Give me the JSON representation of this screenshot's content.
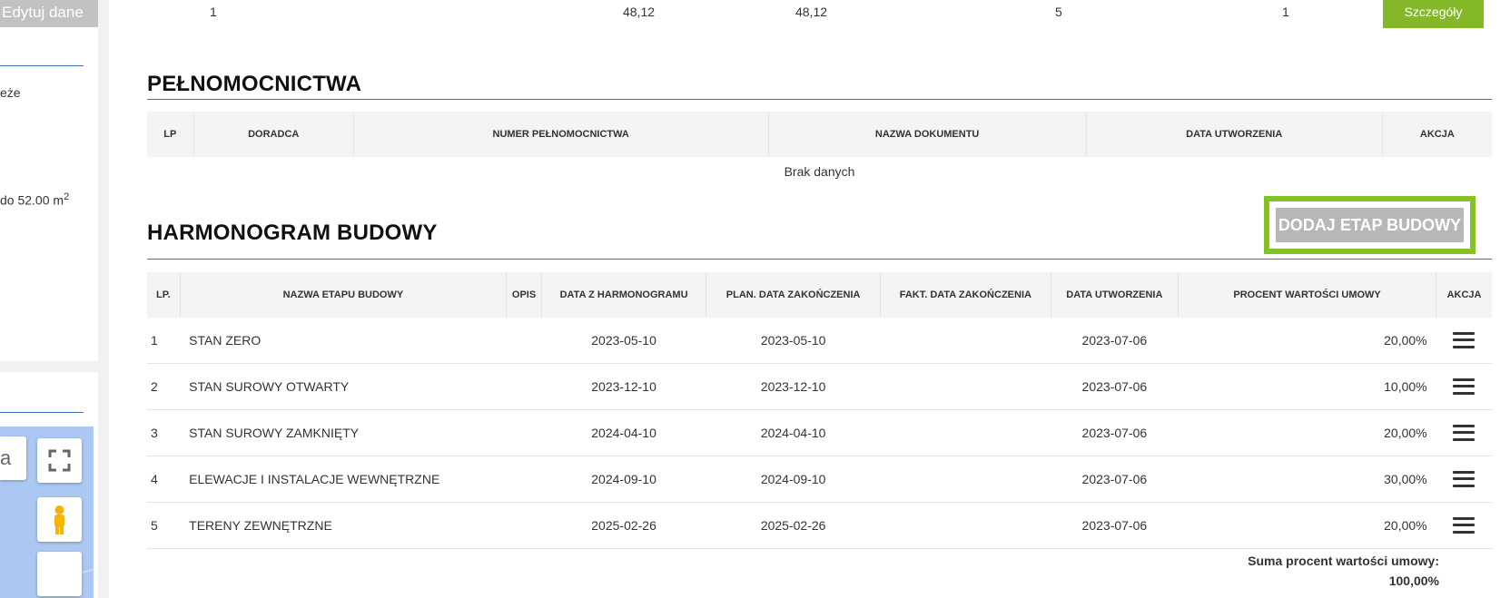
{
  "sidebar": {
    "edit_button": "Edytuj dane",
    "text1": "eże",
    "text2": "do 52.00 m",
    "text2_sup": "2",
    "map_search_text": "a"
  },
  "top_row": {
    "c1": "1",
    "c2": "48,12",
    "c3": "48,12",
    "c4": "5",
    "c5": "1",
    "details_button": "Szczegóły"
  },
  "powers": {
    "title": "PEŁNOMOCNICTWA",
    "headers": [
      "LP",
      "DORADCA",
      "NUMER PEŁNOMOCNICTWA",
      "NAZWA DOKUMENTU",
      "DATA UTWORZENIA",
      "AKCJA"
    ],
    "empty_text": "Brak danych"
  },
  "schedule": {
    "title": "HARMONOGRAM BUDOWY",
    "add_button": "DODAJ ETAP BUDOWY",
    "headers": [
      "LP.",
      "NAZWA ETAPU BUDOWY",
      "OPIS",
      "DATA Z HARMONOGRAMU",
      "PLAN. DATA ZAKOŃCZENIA",
      "FAKT. DATA ZAKOŃCZENIA",
      "DATA UTWORZENIA",
      "PROCENT WARTOŚCI UMOWY",
      "AKCJA"
    ],
    "rows": [
      {
        "lp": "1",
        "name": "STAN ZERO",
        "opis": "",
        "harm": "2023-05-10",
        "plan": "2023-05-10",
        "fakt": "",
        "created": "2023-07-06",
        "percent": "20,00%"
      },
      {
        "lp": "2",
        "name": "STAN SUROWY OTWARTY",
        "opis": "",
        "harm": "2023-12-10",
        "plan": "2023-12-10",
        "fakt": "",
        "created": "2023-07-06",
        "percent": "10,00%"
      },
      {
        "lp": "3",
        "name": "STAN SUROWY ZAMKNIĘTY",
        "opis": "",
        "harm": "2024-04-10",
        "plan": "2024-04-10",
        "fakt": "",
        "created": "2023-07-06",
        "percent": "20,00%"
      },
      {
        "lp": "4",
        "name": "ELEWACJE I INSTALACJE WEWNĘTRZNE",
        "opis": "",
        "harm": "2024-09-10",
        "plan": "2024-09-10",
        "fakt": "",
        "created": "2023-07-06",
        "percent": "30,00%"
      },
      {
        "lp": "5",
        "name": "TERENY ZEWNĘTRZNE",
        "opis": "",
        "harm": "2025-02-26",
        "plan": "2025-02-26",
        "fakt": "",
        "created": "2023-07-06",
        "percent": "20,00%"
      }
    ],
    "sum_label": "Suma procent wartości umowy:",
    "sum_value": "100,00%"
  },
  "icons": {
    "row_action": "menu-icon",
    "fullscreen": "fullscreen-icon",
    "street_view": "pegman-icon"
  },
  "colors": {
    "accent_green": "#84b829",
    "highlight_green": "#84c225",
    "line_blue": "#3f73b8",
    "button_gray": "#b7b7b7"
  }
}
